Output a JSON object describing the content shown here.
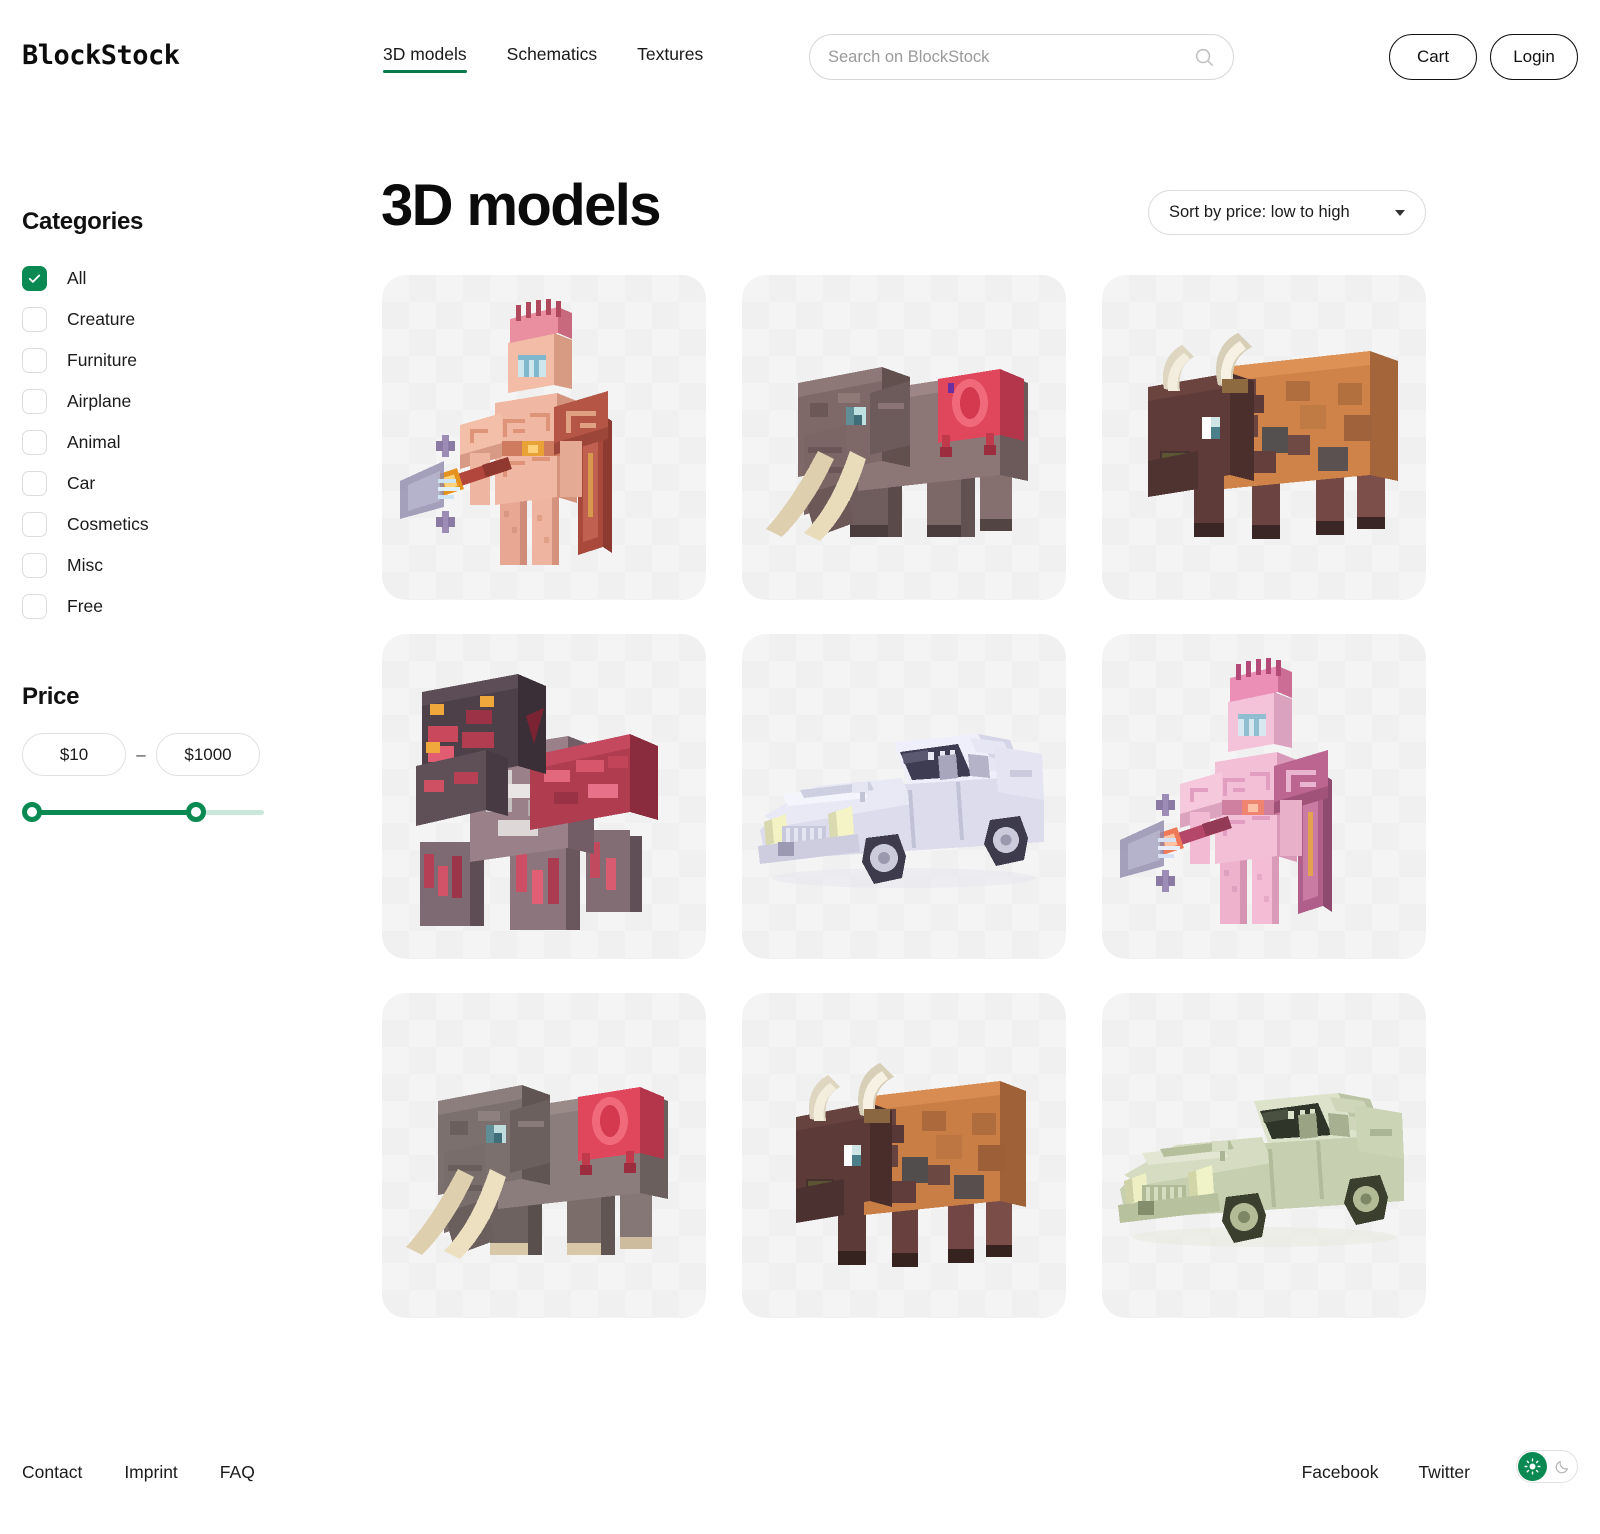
{
  "header": {
    "logo": "BlockStock",
    "nav": [
      {
        "label": "3D models",
        "active": true
      },
      {
        "label": "Schematics",
        "active": false
      },
      {
        "label": "Textures",
        "active": false
      }
    ],
    "search": {
      "value": "",
      "placeholder": "Search on BlockStock",
      "icon": "search-icon"
    },
    "cart_label": "Cart",
    "login_label": "Login"
  },
  "sidebar": {
    "categories_title": "Categories",
    "categories": [
      {
        "label": "All",
        "checked": true
      },
      {
        "label": "Creature",
        "checked": false
      },
      {
        "label": "Furniture",
        "checked": false
      },
      {
        "label": "Airplane",
        "checked": false
      },
      {
        "label": "Animal",
        "checked": false
      },
      {
        "label": "Car",
        "checked": false
      },
      {
        "label": "Cosmetics",
        "checked": false
      },
      {
        "label": "Misc",
        "checked": false
      },
      {
        "label": "Free",
        "checked": false
      }
    ],
    "price_title": "Price",
    "price_min": "$10",
    "price_max": "$1000",
    "price_separator": "–",
    "slider": {
      "min_percent": 0,
      "max_percent": 71
    }
  },
  "main": {
    "title": "3D models",
    "sort_label": "Sort by price: low to high",
    "sort_icon": "chevron-down-icon",
    "items": [
      {
        "name": "greek-warrior-salmon",
        "model": "warrior",
        "palette": "salmon"
      },
      {
        "name": "mammoth-brown",
        "model": "mammoth",
        "palette": "brown"
      },
      {
        "name": "bison-rust",
        "model": "bison",
        "palette": "rust"
      },
      {
        "name": "nether-golem-crimson",
        "model": "golem",
        "palette": "crimson"
      },
      {
        "name": "classic-car-white",
        "model": "car",
        "palette": "white"
      },
      {
        "name": "greek-warrior-pink",
        "model": "warrior",
        "palette": "pink"
      },
      {
        "name": "mammoth-grey",
        "model": "mammoth",
        "palette": "grey"
      },
      {
        "name": "bison-ochre",
        "model": "bison",
        "palette": "ochre"
      },
      {
        "name": "classic-car-green",
        "model": "car",
        "palette": "green"
      }
    ]
  },
  "footer": {
    "left_links": [
      "Contact",
      "Imprint",
      "FAQ"
    ],
    "right_links": [
      "Facebook",
      "Twitter"
    ],
    "theme": {
      "light_icon": "sun-icon",
      "dark_icon": "moon-icon",
      "active": "light"
    }
  },
  "colors": {
    "accent": "#0a8a52",
    "accent_dark": "#0a7a4c",
    "card_bg": "#f4f4f4",
    "text": "#111111",
    "muted": "#9a9a9a"
  }
}
